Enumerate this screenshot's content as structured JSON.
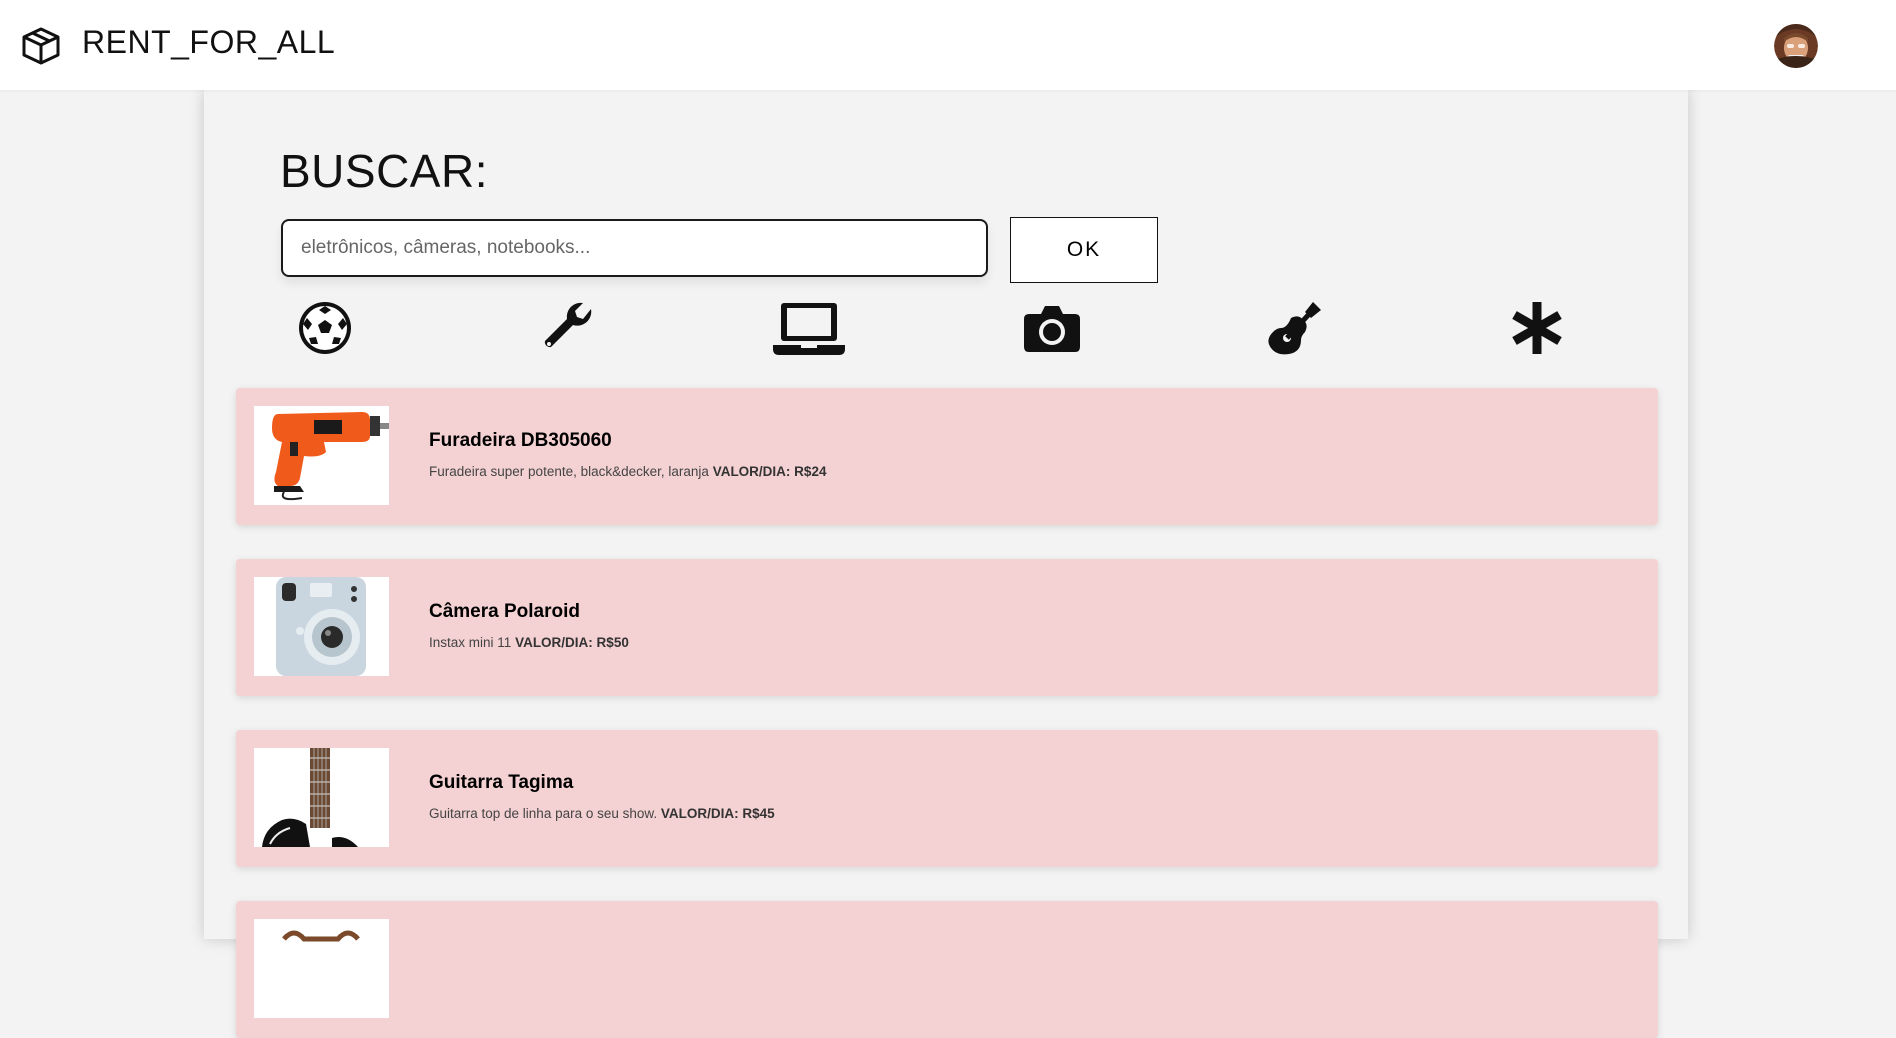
{
  "header": {
    "brand": "RENT_FOR_ALL",
    "logo_icon": "box-icon",
    "avatar_icon": "user-avatar"
  },
  "search": {
    "title": "BUSCAR:",
    "placeholder": "eletrônicos, câmeras, notebooks...",
    "value": "",
    "button_label": "OK"
  },
  "categories": [
    {
      "name": "sports",
      "icon": "soccer-ball-icon"
    },
    {
      "name": "tools",
      "icon": "wrench-icon"
    },
    {
      "name": "electronics",
      "icon": "laptop-icon"
    },
    {
      "name": "cameras",
      "icon": "camera-icon"
    },
    {
      "name": "instruments",
      "icon": "guitar-icon"
    },
    {
      "name": "all",
      "icon": "asterisk-icon"
    }
  ],
  "products": [
    {
      "title": "Furadeira DB305060",
      "description": "Furadeira super potente, black&decker, laranja",
      "price_label": "VALOR/DIA: R$24",
      "image": "drill-image"
    },
    {
      "title": "Câmera Polaroid",
      "description": "Instax mini 11",
      "price_label": "VALOR/DIA: R$50",
      "image": "polaroid-camera-image"
    },
    {
      "title": "Guitarra Tagima",
      "description": "Guitarra top de linha para o seu show.",
      "price_label": "VALOR/DIA: R$45",
      "image": "guitar-image"
    }
  ],
  "colors": {
    "card_bg": "#f4d1d2",
    "page_bg": "#f3f3f3",
    "drill_orange": "#f05a1a"
  }
}
